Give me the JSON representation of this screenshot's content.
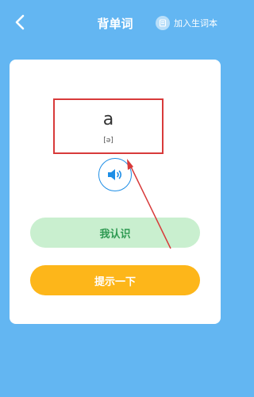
{
  "header": {
    "title": "背单词",
    "add_to_vocab_label": "加入生词本"
  },
  "word": {
    "text": "a",
    "phonetic": "[ə]"
  },
  "buttons": {
    "know_label": "我认识",
    "hint_label": "提示一下"
  },
  "colors": {
    "background": "#63b6f2",
    "know_button": "#c9efcf",
    "hint_button": "#fdb61a",
    "highlight_box": "#d83a3a",
    "speaker": "#1e8ee6"
  },
  "icons": {
    "back": "chevron-left-icon",
    "add_vocab": "notebook-icon",
    "speaker": "speaker-icon"
  }
}
